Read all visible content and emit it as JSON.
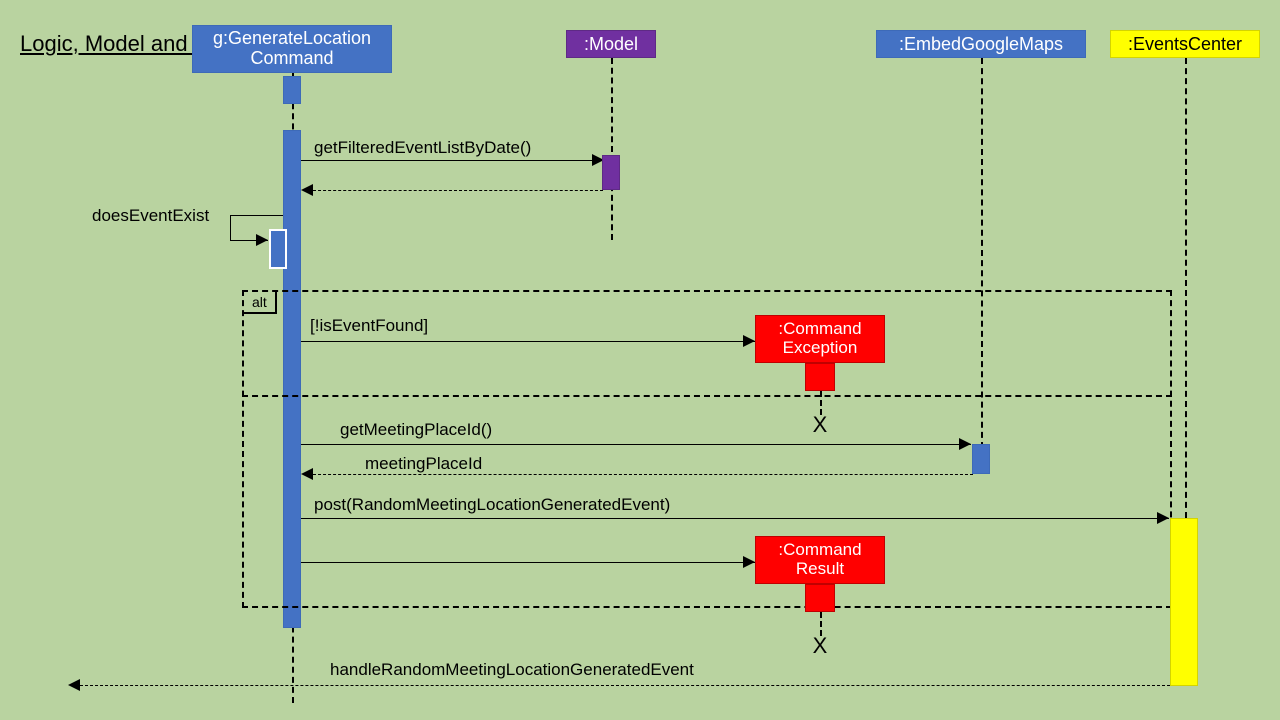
{
  "title": "Logic, Model and Events",
  "participants": {
    "generate": "g:GenerateLocation Command",
    "model": ":Model",
    "embed": ":EmbedGoogleMaps",
    "events": ":EventsCenter"
  },
  "messages": {
    "getFiltered": "getFilteredEventListByDate()",
    "doesEventExist": "doesEventExist",
    "alt": "alt",
    "isEventFound": "[!isEventFound]",
    "cmdException": ":Command Exception",
    "getMeetingPlace": "getMeetingPlaceId()",
    "meetingPlaceId": "meetingPlaceId",
    "post": "post(RandomMeetingLocationGeneratedEvent)",
    "cmdResult": ":Command Result",
    "handle": "handleRandomMeetingLocationGeneratedEvent"
  },
  "x": "X"
}
